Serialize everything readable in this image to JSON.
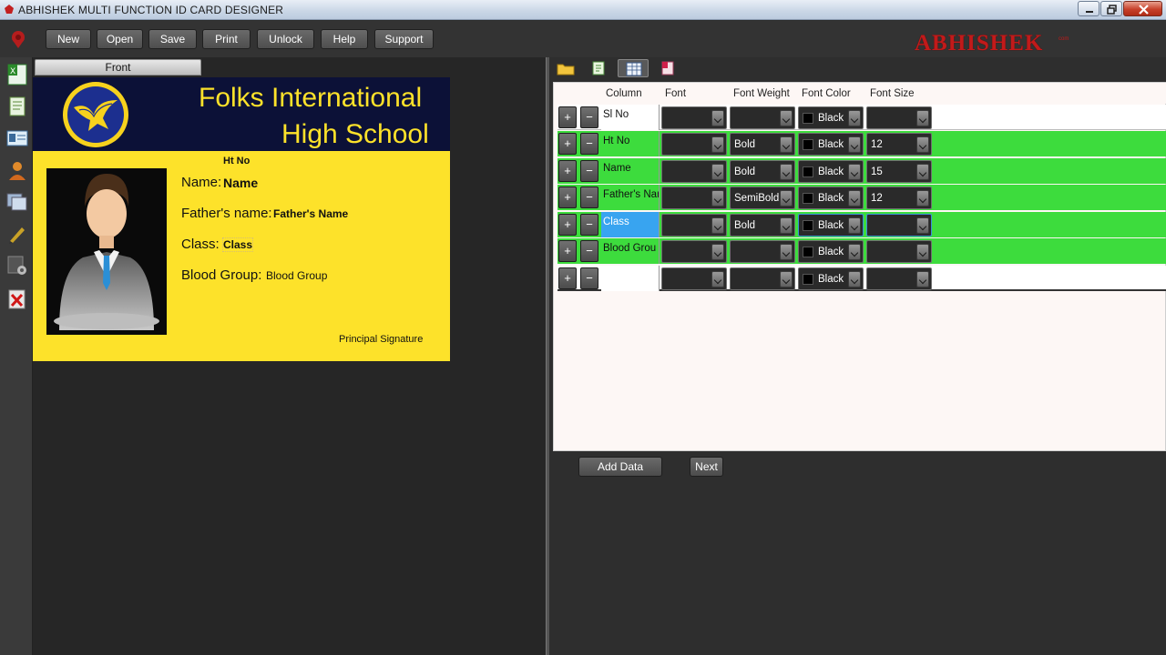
{
  "window": {
    "title": "ABHISHEK MULTI FUNCTION ID CARD DESIGNER"
  },
  "toolbar": {
    "buttons": [
      "New",
      "Open",
      "Save",
      "Print",
      "Unlock",
      "Help",
      "Support"
    ],
    "logo": "ABHISHEK",
    "logo_suffix": "com"
  },
  "designer": {
    "tab": "Front",
    "card": {
      "school_line1": "Folks International",
      "school_line2": "High School",
      "ht_no": "Ht No",
      "name_label": "Name:",
      "name_value": "Name",
      "father_label": "Father's name:",
      "father_value": "Father's Name",
      "class_label": "Class:",
      "class_value": "Class",
      "blood_label": "Blood Group:",
      "blood_value": "Blood Group",
      "signature": "Principal Signature",
      "colors": {
        "header": "#0c1137",
        "body": "#fde22a",
        "title": "#fde22a"
      }
    }
  },
  "grid": {
    "headers": [
      "Column",
      "Font",
      "Font Weight",
      "Font Color",
      "Font Size"
    ],
    "rows": [
      {
        "column": "Sl No",
        "font": "",
        "weight": "",
        "color": "Black",
        "size": "",
        "state": "white"
      },
      {
        "column": "Ht No",
        "font": "",
        "weight": "Bold",
        "color": "Black",
        "size": "12",
        "state": "green"
      },
      {
        "column": "Name",
        "font": "",
        "weight": "Bold",
        "color": "Black",
        "size": "15",
        "state": "green"
      },
      {
        "column": "Father's Nar",
        "font": "",
        "weight": "SemiBold",
        "color": "Black",
        "size": "12",
        "state": "green"
      },
      {
        "column": "Class",
        "font": "",
        "weight": "Bold",
        "color": "Black",
        "size": "",
        "state": "selected"
      },
      {
        "column": "Blood Grou",
        "font": "",
        "weight": "",
        "color": "Black",
        "size": "",
        "state": "green"
      },
      {
        "column": "",
        "font": "",
        "weight": "",
        "color": "Black",
        "size": "",
        "state": "white"
      }
    ],
    "plus": "+",
    "minus": "−"
  },
  "actions": {
    "add_data": "Add Data",
    "next": "Next"
  }
}
